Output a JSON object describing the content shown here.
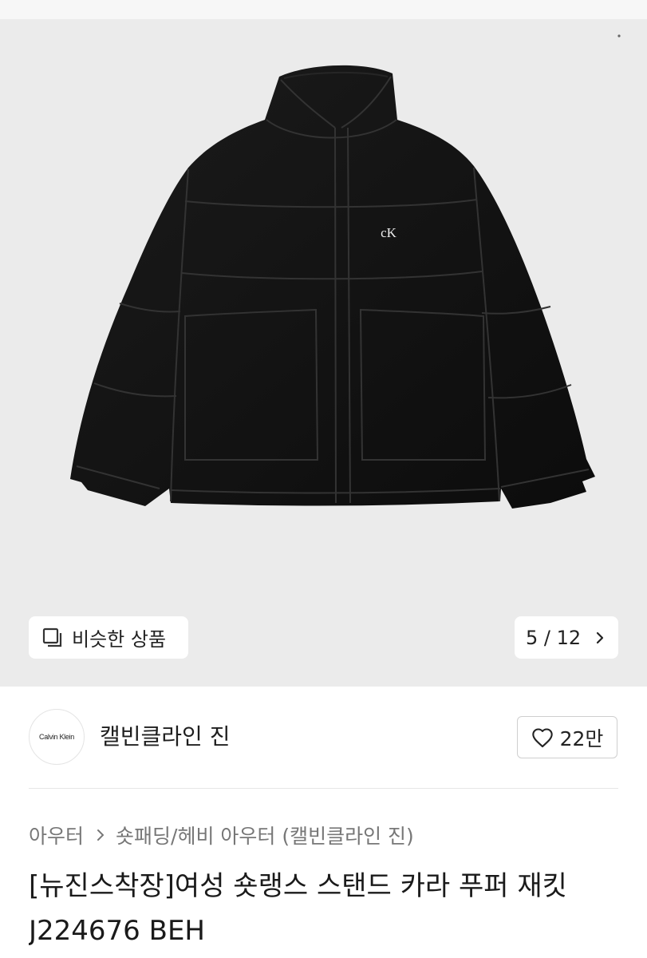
{
  "gallery": {
    "image_logo_text": "cK",
    "similar_button": {
      "label": "비슷한 상품",
      "icon": "similar-items-icon"
    },
    "counter": {
      "label": "5 / 12",
      "icon": "chevron-right-icon"
    }
  },
  "brand": {
    "logo_text": "Calvin Klein",
    "name": "캘빈클라인 진",
    "like_count": "22만",
    "like_icon": "heart-outline-icon"
  },
  "breadcrumb": {
    "items": [
      {
        "label": "아우터"
      },
      {
        "label": "숏패딩/헤비 아우터 (캘빈클라인 진)"
      }
    ],
    "separator_icon": "chevron-right-icon"
  },
  "product": {
    "title": "[뉴진스착장]여성 숏랭스 스탠드 카라 푸퍼 재킷 J224676 BEH"
  },
  "colors": {
    "gallery_background": "#ebebeb",
    "product_color": "#111111",
    "text_primary": "#1a1a1a",
    "text_secondary": "#777777",
    "border": "#cfcfcf",
    "divider": "#e6e6e6"
  }
}
